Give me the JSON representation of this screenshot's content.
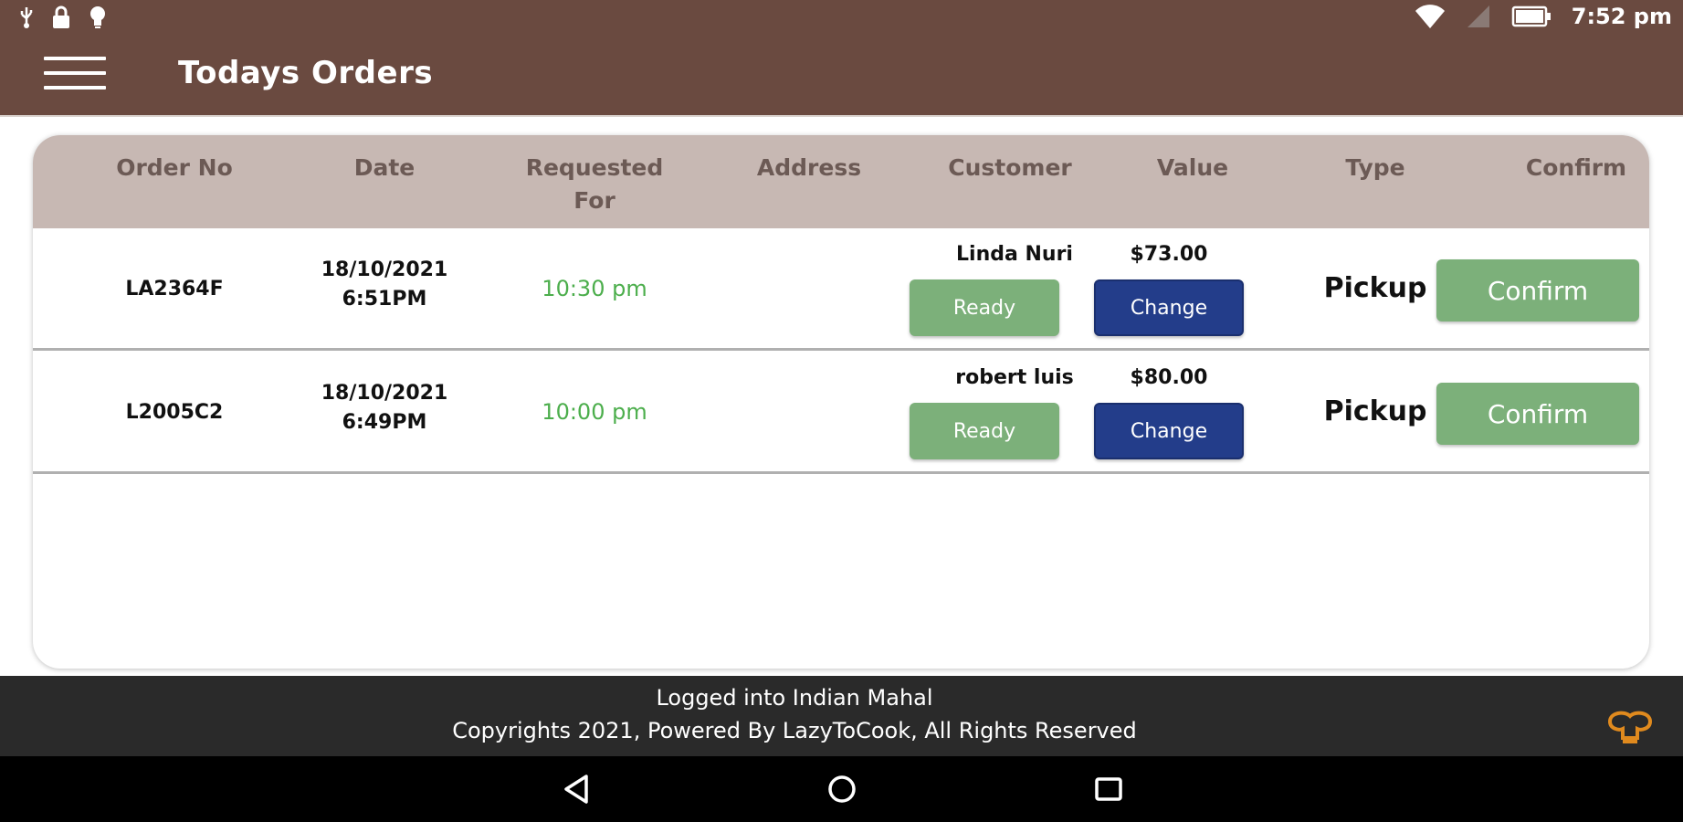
{
  "status_bar": {
    "time": "7:52 pm",
    "icons": [
      "usb-icon",
      "lock-icon",
      "bulb-icon",
      "wifi-icon",
      "signal-icon",
      "battery-icon"
    ]
  },
  "app_bar": {
    "title": "Todays Orders",
    "menu_icon": "hamburger-menu-icon"
  },
  "table": {
    "headers": {
      "order_no": "Order No",
      "date": "Date",
      "requested_for_1": "Requested",
      "requested_for_2": "For",
      "address": "Address",
      "customer": "Customer",
      "value": "Value",
      "type": "Type",
      "confirm": "Confirm"
    },
    "rows": [
      {
        "order_no": "LA2364F",
        "date_line1": "18/10/2021",
        "date_line2": "6:51PM",
        "requested_for": "10:30 pm",
        "address": "",
        "customer": "Linda Nuri",
        "ready_label": "Ready",
        "value": "$73.00",
        "change_label": "Change",
        "type": "Pickup",
        "confirm_label": "Confirm"
      },
      {
        "order_no": "L2005C2",
        "date_line1": "18/10/2021",
        "date_line2": "6:49PM",
        "requested_for": "10:00 pm",
        "address": "",
        "customer": "robert luis",
        "ready_label": "Ready",
        "value": "$80.00",
        "change_label": "Change",
        "type": "Pickup",
        "confirm_label": "Confirm"
      }
    ]
  },
  "footer": {
    "logged_in": "Logged into Indian Mahal",
    "copyright": "Copyrights 2021, Powered By LazyToCook, All Rights Reserved"
  },
  "colors": {
    "app_bar": "#6a4a40",
    "table_header": "#c7b8b3",
    "ready_button": "#7cb07a",
    "change_button": "#233d8a",
    "confirm_button": "#7cb07a",
    "requested_time": "#4cae4c",
    "footer": "#2a2a2a"
  }
}
